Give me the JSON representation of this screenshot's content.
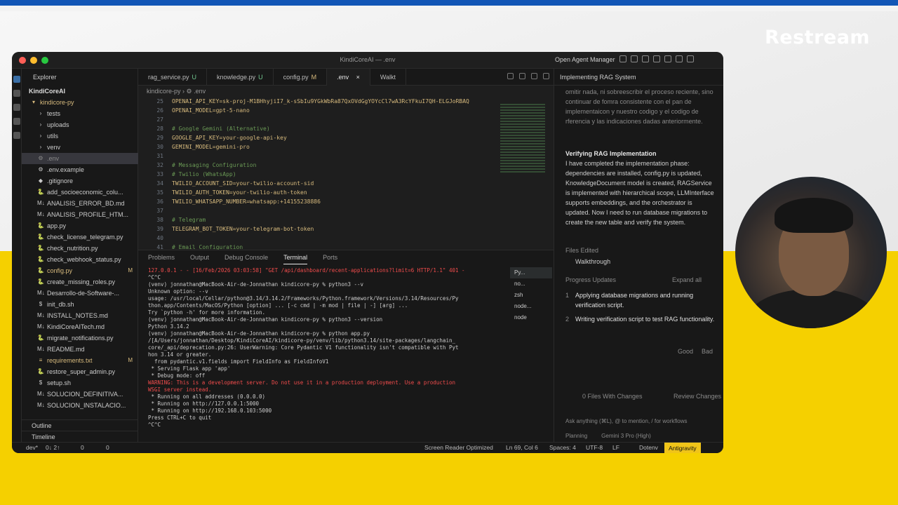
{
  "brand": "Restream",
  "window": {
    "title": "KindiCoreAI — .env",
    "open_agent_manager": "Open Agent Manager"
  },
  "explorer": {
    "header": "Explorer",
    "root": "KindiCoreAI",
    "items": [
      {
        "label": "kindicore-py",
        "icon": "▾",
        "status": "",
        "color": "#d7ba7d"
      },
      {
        "label": "tests",
        "icon": "›",
        "status": "",
        "color": "#cccccc"
      },
      {
        "label": "uploads",
        "icon": "›",
        "status": "",
        "color": "#cccccc"
      },
      {
        "label": "utils",
        "icon": "›",
        "status": "",
        "color": "#cccccc"
      },
      {
        "label": "venv",
        "icon": "›",
        "status": "",
        "color": "#cccccc"
      },
      {
        "label": ".env",
        "icon": "⚙",
        "status": "",
        "color": "#8a8a8a"
      },
      {
        "label": ".env.example",
        "icon": "⚙",
        "status": "",
        "color": "#cccccc"
      },
      {
        "label": ".gitignore",
        "icon": "◆",
        "status": "",
        "color": "#cccccc"
      },
      {
        "label": "add_socioeconomic_colu...",
        "icon": "🐍",
        "status": "",
        "color": "#cccccc"
      },
      {
        "label": "ANALISIS_ERROR_BD.md",
        "icon": "M↓",
        "status": "",
        "color": "#cccccc"
      },
      {
        "label": "ANALISIS_PROFILE_HTM...",
        "icon": "M↓",
        "status": "",
        "color": "#cccccc"
      },
      {
        "label": "app.py",
        "icon": "🐍",
        "status": "",
        "color": "#cccccc"
      },
      {
        "label": "check_license_telegram.py",
        "icon": "🐍",
        "status": "",
        "color": "#cccccc"
      },
      {
        "label": "check_nutrition.py",
        "icon": "🐍",
        "status": "",
        "color": "#cccccc"
      },
      {
        "label": "check_webhook_status.py",
        "icon": "🐍",
        "status": "",
        "color": "#cccccc"
      },
      {
        "label": "config.py",
        "icon": "🐍",
        "status": "M",
        "color": "#d7ba7d"
      },
      {
        "label": "create_missing_roles.py",
        "icon": "🐍",
        "status": "",
        "color": "#cccccc"
      },
      {
        "label": "Desarrollo-de-Software-...",
        "icon": "M↓",
        "status": "",
        "color": "#cccccc"
      },
      {
        "label": "init_db.sh",
        "icon": "$",
        "status": "",
        "color": "#cccccc"
      },
      {
        "label": "INSTALL_NOTES.md",
        "icon": "M↓",
        "status": "",
        "color": "#cccccc"
      },
      {
        "label": "KindiCoreAITech.md",
        "icon": "M↓",
        "status": "",
        "color": "#cccccc"
      },
      {
        "label": "migrate_notifications.py",
        "icon": "🐍",
        "status": "",
        "color": "#cccccc"
      },
      {
        "label": "README.md",
        "icon": "M↓",
        "status": "",
        "color": "#cccccc"
      },
      {
        "label": "requirements.txt",
        "icon": "≡",
        "status": "M",
        "color": "#d7ba7d"
      },
      {
        "label": "restore_super_admin.py",
        "icon": "🐍",
        "status": "",
        "color": "#cccccc"
      },
      {
        "label": "setup.sh",
        "icon": "$",
        "status": "",
        "color": "#cccccc"
      },
      {
        "label": "SOLUCION_DEFINITIVA...",
        "icon": "M↓",
        "status": "",
        "color": "#cccccc"
      },
      {
        "label": "SOLUCION_INSTALACIO...",
        "icon": "M↓",
        "status": "",
        "color": "#cccccc"
      }
    ],
    "outline": "Outline",
    "timeline": "Timeline"
  },
  "tabs": [
    {
      "label": "rag_service.py",
      "badge": "U",
      "active": false
    },
    {
      "label": "knowledge.py",
      "badge": "U",
      "active": false
    },
    {
      "label": "config.py",
      "badge": "M",
      "active": false
    },
    {
      "label": ".env",
      "badge": "",
      "active": true
    },
    {
      "label": "Walkt",
      "badge": "",
      "active": false
    }
  ],
  "breadcrumb": "kindicore-py  ›  ⚙ .env",
  "editor": {
    "lines": [
      {
        "n": "25",
        "text": "OPENAI_API_KEY=sk-proj-M1BHhyjiI7_k-sSbIu9YGkWbRa87QxOVdGgYOYcCl7wA3RcYFkuI7QH-ELGJoRBAQ",
        "type": "code"
      },
      {
        "n": "26",
        "text": "OPENAI_MODEL=gpt-5-nano",
        "type": "code"
      },
      {
        "n": "27",
        "text": "",
        "type": "code"
      },
      {
        "n": "28",
        "text": "# Google Gemini (Alternative)",
        "type": "cm"
      },
      {
        "n": "29",
        "text": "GOOGLE_API_KEY=your-google-api-key",
        "type": "code"
      },
      {
        "n": "30",
        "text": "GEMINI_MODEL=gemini-pro",
        "type": "code"
      },
      {
        "n": "31",
        "text": "",
        "type": "code"
      },
      {
        "n": "32",
        "text": "# Messaging Configuration",
        "type": "cm"
      },
      {
        "n": "33",
        "text": "# Twilio (WhatsApp)",
        "type": "cm"
      },
      {
        "n": "34",
        "text": "TWILIO_ACCOUNT_SID=your-twilio-account-sid",
        "type": "code"
      },
      {
        "n": "35",
        "text": "TWILIO_AUTH_TOKEN=your-twilio-auth-token",
        "type": "code"
      },
      {
        "n": "36",
        "text": "TWILIO_WHATSAPP_NUMBER=whatsapp:+14155238886",
        "type": "code"
      },
      {
        "n": "37",
        "text": "",
        "type": "code"
      },
      {
        "n": "38",
        "text": "# Telegram",
        "type": "cm"
      },
      {
        "n": "39",
        "text": "TELEGRAM_BOT_TOKEN=your-telegram-bot-token",
        "type": "code"
      },
      {
        "n": "40",
        "text": "",
        "type": "code"
      },
      {
        "n": "41",
        "text": "# Email Configuration",
        "type": "cm"
      }
    ]
  },
  "panel": {
    "tabs": [
      "Problems",
      "Output",
      "Debug Console",
      "Terminal",
      "Ports"
    ],
    "active_tab": "Terminal",
    "terminal_lines": [
      {
        "text": "127.0.0.1 - - [16/Feb/2026 03:03:58] \"GET /api/dashboard/recent-applications?limit=6 HTTP/1.1\" 401 -",
        "type": "warn"
      },
      {
        "text": "^C^C",
        "type": "prompt"
      },
      {
        "text": "(venv) jonnathan@MacBook-Air-de-Jonnathan kindicore-py % python3 --v",
        "type": "prompt"
      },
      {
        "text": "Unknown option: --v",
        "type": "prompt"
      },
      {
        "text": "usage: /usr/local/Cellar/python@3.14/3.14.2/Frameworks/Python.framework/Versions/3.14/Resources/Py",
        "type": "prompt"
      },
      {
        "text": "thon.app/Contents/MacOS/Python [option] ... [-c cmd | -m mod | file | -] [arg] ...",
        "type": "prompt"
      },
      {
        "text": "Try `python -h' for more information.",
        "type": "prompt"
      },
      {
        "text": "(venv) jonnathan@MacBook-Air-de-Jonnathan kindicore-py % python3 --version",
        "type": "prompt"
      },
      {
        "text": "Python 3.14.2",
        "type": "prompt"
      },
      {
        "text": "(venv) jonnathan@MacBook-Air-de-Jonnathan kindicore-py % python app.py",
        "type": "prompt"
      },
      {
        "text": "/[A/Users/jonnathan/Desktop/KindiCoreAI/kindicore-py/venv/lib/python3.14/site-packages/langchain_",
        "type": "prompt"
      },
      {
        "text": "core/_api/deprecation.py:26: UserWarning: Core Pydantic V1 functionality isn't compatible with Pyt",
        "type": "prompt"
      },
      {
        "text": "hon 3.14 or greater.",
        "type": "prompt"
      },
      {
        "text": "  from pydantic.v1.fields import FieldInfo as FieldInfoV1",
        "type": "prompt"
      },
      {
        "text": " * Serving Flask app 'app'",
        "type": "prompt"
      },
      {
        "text": " * Debug mode: off",
        "type": "prompt"
      },
      {
        "text": "WARNING: This is a development server. Do not use it in a production deployment. Use a production",
        "type": "warn"
      },
      {
        "text": "WSGI server instead.",
        "type": "warn"
      },
      {
        "text": " * Running on all addresses (0.0.0.0)",
        "type": "prompt"
      },
      {
        "text": " * Running on http://127.0.0.1:5000",
        "type": "prompt"
      },
      {
        "text": " * Running on http://192.168.0.103:5000",
        "type": "prompt"
      },
      {
        "text": "Press CTRL+C to quit",
        "type": "prompt"
      },
      {
        "text": "^C^C",
        "type": "prompt"
      }
    ],
    "terminal_list": [
      "Py...",
      "no...",
      "zsh",
      "node...",
      "node"
    ]
  },
  "chat": {
    "header": "Implementing RAG System",
    "prev_text": "omitir nada, ni sobreescribir el proceso reciente, sino continuar de fomra consistente con el pan de implementaicon y nuestro codigo y el codigo de rferencia y las indicaciones dadas anteriormente.",
    "section_title": "Verifying RAG Implementation",
    "section_body": "I have completed the implementation phase: dependencies are installed, config.py is updated, KnowledgeDocument model is created, RAGService is implemented with hierarchical scope, LLMInterface supports embeddings, and the orchestrator is updated. Now I need to run database migrations to create the new table and verify the system.",
    "files_edited": "Files Edited",
    "walkthrough": "Walkthrough",
    "progress_updates": "Progress Updates",
    "expand_all": "Expand all",
    "progress": [
      {
        "n": "1",
        "text": "Applying database migrations and running verification script."
      },
      {
        "n": "2",
        "text": "Writing verification script to test RAG functionality."
      }
    ],
    "good": "Good",
    "bad": "Bad",
    "files_with_changes": "0 Files With Changes",
    "review_changes": "Review Changes",
    "input_placeholder": "Ask anything (⌘L), @ to mention, / for workflows",
    "planning": "Planning",
    "model": "Gemini 3 Pro (High)"
  },
  "status": {
    "branch": "dev*",
    "sync": "0↓ 2↑",
    "errors": "0",
    "warnings": "0",
    "screen_reader": "Screen Reader Optimized",
    "position": "Ln 69, Col 6",
    "spaces": "Spaces: 4",
    "encoding": "UTF-8",
    "eol": "LF",
    "lang": "Dotenv",
    "antigravity": "Antigravity"
  }
}
